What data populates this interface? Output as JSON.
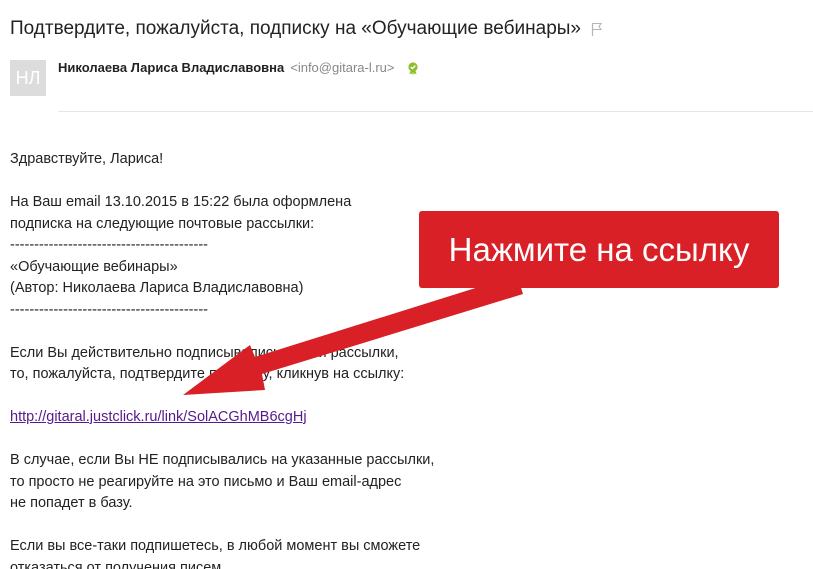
{
  "email": {
    "subject": "Подтвердите, пожалуйста, подписку на «Обучающие вебинары»",
    "sender": {
      "avatar_initials": "НЛ",
      "name": "Николаева Лариса Владиславовна",
      "email": "<info@gitara-l.ru>"
    },
    "body": {
      "greeting": "Здравствуйте, Лариса!",
      "intro_line1": "На Ваш email 13.10.2015 в 15:22 была оформлена",
      "intro_line2": "подписка на следующие почтовые рассылки:",
      "separator1": "-----------------------------------------",
      "list_name": "«Обучающие вебинары»",
      "list_author": "(Автор: Николаева Лариса Владиславовна)",
      "separator2": "-----------------------------------------",
      "confirm_line1": "Если Вы действительно подписывались на эти рассылки,",
      "confirm_line2": "то, пожалуйста, подтвердите подписку, кликнув на ссылку:",
      "link_text": "http://gitaral.justclick.ru/link/SolACGhMB6cgHj",
      "ignore_line1": "В случае, если Вы НЕ подписывались на указанные рассылки,",
      "ignore_line2": "то просто не реагируйте на это письмо и Ваш email-адрес",
      "ignore_line3": "не попадет в базу.",
      "unsub_line1": "Если вы все-таки подпишетесь, в любой момент вы сможете",
      "unsub_line2": "отказаться от получения писем."
    }
  },
  "annotation": {
    "callout_text": "Нажмите на ссылку",
    "color": "#d92026"
  },
  "icons": {
    "flag": "flag-icon",
    "verified": "verified-icon"
  }
}
